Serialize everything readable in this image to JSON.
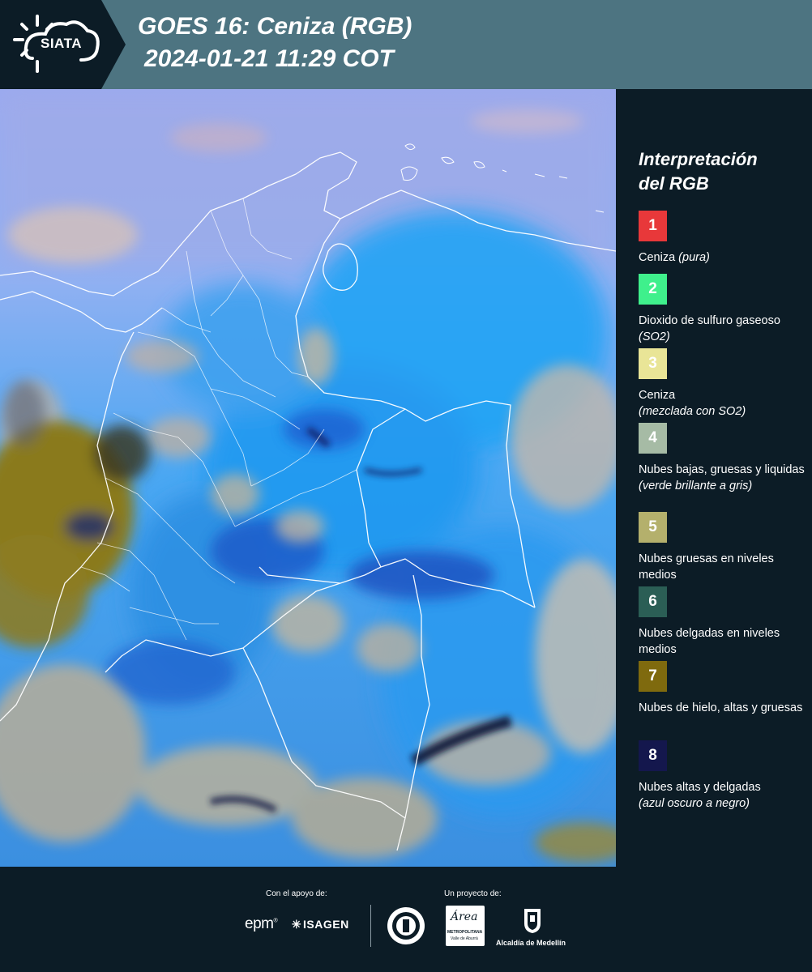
{
  "header": {
    "logo_text": "SIATA",
    "title_line1": "GOES 16: Ceniza (RGB)",
    "title_line2": "2024-01-21 11:29 COT"
  },
  "legend": {
    "title_line1": "Interpretación",
    "title_line2": "del RGB",
    "items": [
      {
        "number": "1",
        "color": "#e8383a",
        "text_main": "Ceniza ",
        "text_italic": "(pura)"
      },
      {
        "number": "2",
        "color": "#3ff08c",
        "text_main": "Dioxido de sulfuro gaseoso ",
        "text_italic": "(SO2)"
      },
      {
        "number": "3",
        "color": "#e9e597",
        "text_main": "Ceniza",
        "text_italic": "(mezclada con SO2)"
      },
      {
        "number": "4",
        "color": "#a6bba5",
        "text_main": "Nubes bajas, gruesas y liquidas",
        "text_italic": "(verde brillante a gris)"
      },
      {
        "number": "5",
        "color": "#b4b06c",
        "text_main": "Nubes gruesas en niveles medios",
        "text_italic": ""
      },
      {
        "number": "6",
        "color": "#2b5e55",
        "text_main": "Nubes delgadas en niveles medios",
        "text_italic": ""
      },
      {
        "number": "7",
        "color": "#7f6a0e",
        "text_main": "Nubes de hielo, altas y gruesas",
        "text_italic": ""
      },
      {
        "number": "8",
        "color": "#14174d",
        "text_main": "Nubes altas y delgadas",
        "text_italic": "(azul oscuro a negro)"
      }
    ]
  },
  "footer": {
    "support_label": "Con el apoyo de:",
    "project_label": "Un proyecto de:",
    "sponsor_epm": "epm",
    "sponsor_isagen": "ISAGEN",
    "area_logo_text": "Área",
    "area_sub1": "METROPOLITANA",
    "area_sub2": "Valle de Aburrá",
    "alcaldia": "Alcaldía de Medellín"
  },
  "colors": {
    "header_bg": "#4d7481",
    "page_bg": "#0c1c26",
    "map_blue": "#2f9bf0",
    "map_pale": "#99a8e8",
    "map_tan": "#c9b9a0",
    "map_olive": "#8a7a1c"
  }
}
